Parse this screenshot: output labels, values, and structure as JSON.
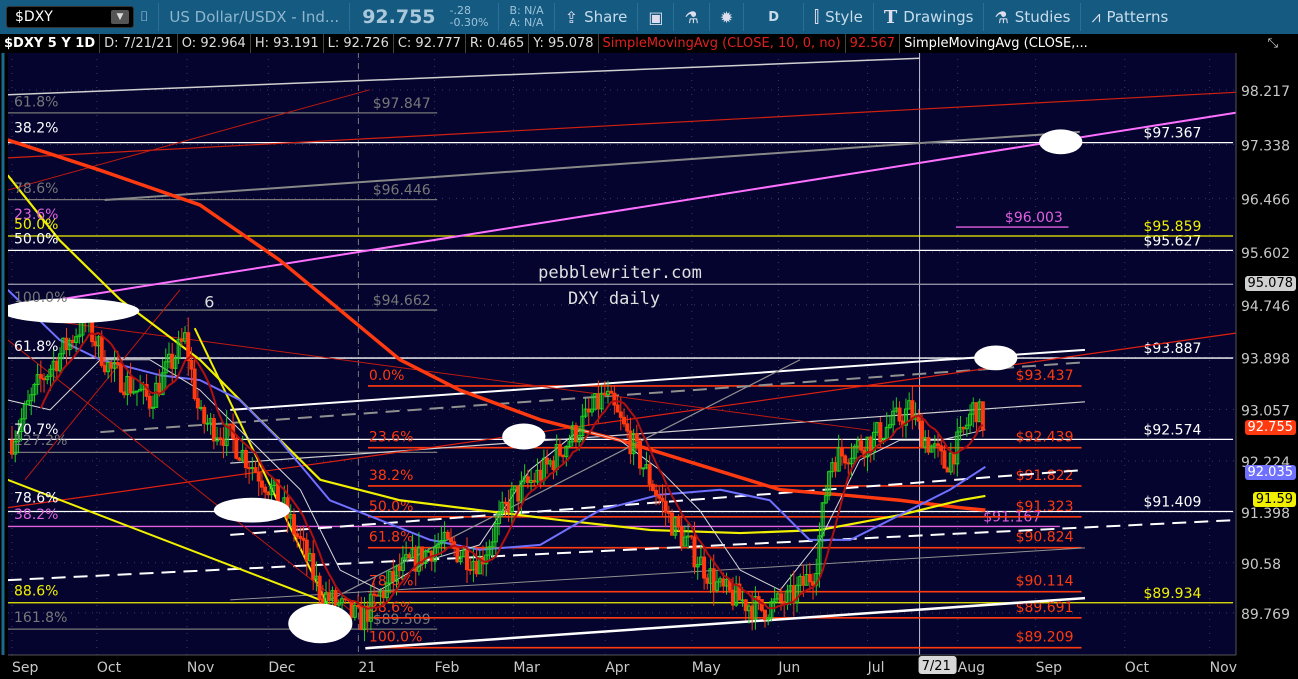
{
  "toolbar": {
    "symbol": "$DXY",
    "description": "US Dollar/USDX - Ind...",
    "last": "92.755",
    "change": "-.28",
    "change_pct": "-0.30%",
    "bid": "B: N/A",
    "ask": "A: N/A",
    "share": "Share",
    "aggregation": "D",
    "style": "Style",
    "drawings": "Drawings",
    "studies": "Studies",
    "patterns": "Patterns"
  },
  "status": {
    "title": "$DXY 5 Y 1D",
    "date": "D: 7/21/21",
    "open": "O: 92.964",
    "high": "H: 93.191",
    "low": "L: 92.726",
    "close": "C: 92.777",
    "range": "R: 0.465",
    "year": "Y: 95.078",
    "study1": "SimpleMovingAvg (CLOSE, 10, 0, no)",
    "study1_value": "92.567",
    "study2": "SimpleMovingAvg (CLOSE,..."
  },
  "colors": {
    "bg": "#04042e",
    "red": "#ff3a10",
    "yellow": "#f0f000",
    "pink": "#e060e0",
    "blue": "#7070ff",
    "white": "#ffffff",
    "gray": "#808080",
    "darkred": "#b01010"
  },
  "chart_data": {
    "type": "line",
    "title": "$DXY 5 Y 1D",
    "annotation_text": [
      "pebblewriter.com",
      "DXY daily"
    ],
    "ylim": [
      89.2,
      98.6
    ],
    "y_ticks": [
      98.217,
      97.338,
      96.466,
      95.602,
      94.746,
      93.898,
      93.057,
      92.224,
      91.398,
      90.58,
      89.769
    ],
    "x_ticks": [
      {
        "label": "Sep",
        "t": 0
      },
      {
        "label": "Oct",
        "t": 0.98
      },
      {
        "label": "Nov",
        "t": 2.02
      },
      {
        "label": "Dec",
        "t": 2.96
      },
      {
        "label": "21",
        "t": 4.0
      },
      {
        "label": "Feb",
        "t": 4.88
      },
      {
        "label": "Mar",
        "t": 5.79
      },
      {
        "label": "Apr",
        "t": 6.85
      },
      {
        "label": "May",
        "t": 7.85
      },
      {
        "label": "Jun",
        "t": 8.85
      },
      {
        "label": "Jul",
        "t": 9.88
      },
      {
        "label": "Aug",
        "t": 10.92
      },
      {
        "label": "Sep",
        "t": 11.82
      },
      {
        "label": "Oct",
        "t": 12.85
      },
      {
        "label": "Nov",
        "t": 13.83
      }
    ],
    "cursor": {
      "label": "7/21",
      "t": 10.48
    },
    "price_badges": [
      {
        "value": "95.078",
        "price": 95.078,
        "color": "#d0d0d0",
        "text": "#000"
      },
      {
        "value": "92.755",
        "price": 92.755,
        "color": "#ff3a10",
        "text": "#fff"
      },
      {
        "value": "92.035",
        "price": 92.035,
        "color": "#7070ff",
        "text": "#fff"
      },
      {
        "value": "91.59",
        "price": 91.59,
        "color": "#f0f000",
        "text": "#000"
      }
    ],
    "close_series": {
      "name": "$DXY close (approx)",
      "t": [
        0,
        0.32,
        0.84,
        1.13,
        1.59,
        2.0,
        2.17,
        2.52,
        3.09,
        3.33,
        3.56,
        4.02,
        4.48,
        4.94,
        5.4,
        5.75,
        6.15,
        6.85,
        7.14,
        7.6,
        8.18,
        8.64,
        8.98,
        9.27,
        9.45,
        9.91,
        10.37,
        10.48,
        10.77,
        10.95,
        11.12,
        11.24
      ],
      "values": [
        92.56,
        93.5,
        94.5,
        93.7,
        93.2,
        94.2,
        92.9,
        92.6,
        91.6,
        90.9,
        90.1,
        89.65,
        90.46,
        90.9,
        90.6,
        91.6,
        92.08,
        93.29,
        92.56,
        91.27,
        90.14,
        89.82,
        89.98,
        90.46,
        92.24,
        92.56,
        93.05,
        92.72,
        92.16,
        92.56,
        93.13,
        92.76
      ]
    },
    "moving_averages": [
      {
        "name": "sma-red-long",
        "color": "#ff3a10",
        "width": 3.5,
        "points": [
          [
            -0.05,
            97.41
          ],
          [
            1.02,
            96.92
          ],
          [
            2.17,
            96.36
          ],
          [
            3.09,
            95.47
          ],
          [
            3.79,
            94.66
          ],
          [
            4.48,
            93.86
          ],
          [
            5.17,
            93.37
          ],
          [
            6.1,
            92.89
          ],
          [
            7.02,
            92.56
          ],
          [
            7.94,
            92.16
          ],
          [
            8.87,
            91.76
          ],
          [
            9.56,
            91.68
          ],
          [
            10.25,
            91.59
          ],
          [
            10.95,
            91.47
          ],
          [
            11.24,
            91.43
          ]
        ]
      },
      {
        "name": "sma-yellow",
        "color": "#f0f000",
        "width": 2.2,
        "points": [
          [
            -0.05,
            96.84
          ],
          [
            0.55,
            95.79
          ],
          [
            1.25,
            94.83
          ],
          [
            2.17,
            93.86
          ],
          [
            2.86,
            92.89
          ],
          [
            3.56,
            91.92
          ],
          [
            4.48,
            91.59
          ],
          [
            5.4,
            91.43
          ],
          [
            6.33,
            91.27
          ],
          [
            7.37,
            91.11
          ],
          [
            8.41,
            91.06
          ],
          [
            9.33,
            91.11
          ],
          [
            10.25,
            91.35
          ],
          [
            10.95,
            91.59
          ],
          [
            11.24,
            91.66
          ]
        ]
      },
      {
        "name": "sma-blue",
        "color": "#7070ff",
        "width": 2,
        "points": [
          [
            -0.05,
            94.99
          ],
          [
            0.55,
            94.18
          ],
          [
            1.02,
            93.86
          ],
          [
            1.71,
            93.61
          ],
          [
            2.17,
            93.53
          ],
          [
            2.63,
            93.21
          ],
          [
            3.09,
            92.56
          ],
          [
            3.67,
            91.59
          ],
          [
            4.25,
            91.27
          ],
          [
            4.83,
            90.95
          ],
          [
            5.4,
            90.79
          ],
          [
            6.1,
            90.87
          ],
          [
            6.79,
            91.43
          ],
          [
            7.48,
            91.68
          ],
          [
            8.18,
            91.76
          ],
          [
            8.75,
            91.59
          ],
          [
            9.21,
            90.95
          ],
          [
            9.68,
            90.95
          ],
          [
            10.25,
            91.35
          ],
          [
            10.83,
            91.76
          ],
          [
            11.24,
            92.13
          ]
        ]
      },
      {
        "name": "sma-white",
        "color": "#d8d8d8",
        "width": 1,
        "points": [
          [
            -0.05,
            93.21
          ],
          [
            0.44,
            93.05
          ],
          [
            1.02,
            93.86
          ],
          [
            1.59,
            93.86
          ],
          [
            2.17,
            93.37
          ],
          [
            2.75,
            92.56
          ],
          [
            3.33,
            91.76
          ],
          [
            3.79,
            90.46
          ],
          [
            4.25,
            90.14
          ],
          [
            4.83,
            90.63
          ],
          [
            5.4,
            90.87
          ],
          [
            5.98,
            92.08
          ],
          [
            6.56,
            92.73
          ],
          [
            7.02,
            92.56
          ],
          [
            7.48,
            92.08
          ],
          [
            7.94,
            91.43
          ],
          [
            8.41,
            90.46
          ],
          [
            8.87,
            90.14
          ],
          [
            9.33,
            90.95
          ],
          [
            9.79,
            92.24
          ],
          [
            10.25,
            92.56
          ],
          [
            10.72,
            92.56
          ],
          [
            11.24,
            92.73
          ]
        ]
      }
    ],
    "trendlines": [
      {
        "color": "#ff70ff",
        "w": 2,
        "a": [
          -0.05,
          94.7
        ],
        "b": [
          14.13,
          97.85
        ]
      },
      {
        "color": "#d0d0d0",
        "w": 1.5,
        "a": [
          -0.05,
          98.14
        ],
        "b": [
          10.48,
          98.73
        ]
      },
      {
        "color": "#d02010",
        "w": 1.2,
        "a": [
          -0.05,
          97.12
        ],
        "b": [
          14.13,
          98.18
        ]
      },
      {
        "color": "#888888",
        "w": 2,
        "a": [
          1.07,
          96.44
        ],
        "b": [
          12.33,
          97.54
        ]
      },
      {
        "color": "#ffffff",
        "w": 2,
        "a": [
          2.52,
          93.05
        ],
        "b": [
          12.39,
          94.02
        ]
      },
      {
        "color": "#d0d0d0",
        "w": 1.2,
        "a": [
          2.52,
          92.19
        ],
        "b": [
          12.39,
          93.18
        ]
      },
      {
        "color": "#ffffff",
        "w": 2.5,
        "a": [
          4.08,
          89.2
        ],
        "b": [
          12.39,
          90.01
        ]
      },
      {
        "color": "#ffffff",
        "w": 2,
        "dash": "14 8",
        "a": [
          -0.05,
          90.3
        ],
        "b": [
          14.13,
          91.27
        ]
      },
      {
        "color": "#ffffff",
        "w": 2,
        "dash": "14 8",
        "a": [
          2.52,
          91.03
        ],
        "b": [
          12.39,
          92.08
        ]
      },
      {
        "color": "#909090",
        "w": 2,
        "dash": "14 8",
        "a": [
          1.02,
          92.69
        ],
        "b": [
          12.39,
          93.82
        ]
      },
      {
        "color": "#e02010",
        "w": 1.2,
        "a": [
          -0.05,
          91.47
        ],
        "b": [
          14.13,
          94.29
        ]
      },
      {
        "color": "#909090",
        "w": 1.2,
        "a": [
          3.67,
          89.98
        ],
        "b": [
          9.1,
          93.86
        ]
      },
      {
        "color": "#909090",
        "w": 1,
        "a": [
          2.52,
          89.98
        ],
        "b": [
          12.39,
          90.82
        ]
      },
      {
        "color": "#c01a10",
        "w": 1,
        "a": [
          -0.05,
          94.58
        ],
        "b": [
          9.91,
          92.72
        ]
      },
      {
        "color": "#f0f000",
        "w": 2,
        "a": [
          -0.05,
          91.92
        ],
        "b": [
          3.56,
          89.98
        ]
      },
      {
        "color": "#f0f000",
        "w": 2,
        "a": [
          2.11,
          94.37
        ],
        "b": [
          3.67,
          89.82
        ]
      },
      {
        "color": "#c01a10",
        "w": 1,
        "a": [
          -0.05,
          94.18
        ],
        "b": [
          3.9,
          89.82
        ]
      },
      {
        "color": "#c01a10",
        "w": 1,
        "a": [
          0.15,
          91.92
        ],
        "b": [
          1.94,
          94.99
        ]
      },
      {
        "color": "#c01a10",
        "w": 1,
        "a": [
          -0.05,
          96.6
        ],
        "b": [
          4.13,
          98.22
        ]
      }
    ],
    "levels": [
      {
        "price": 97.367,
        "label": "$97.367",
        "color": "#ffffff",
        "from": -0.1,
        "to": 14.1,
        "label_t": 13.4
      },
      {
        "price": 95.627,
        "label": "$95.627",
        "color": "#ffffff",
        "from": -0.1,
        "to": 14.1,
        "label_t": 13.4
      },
      {
        "price": 95.859,
        "label": "$95.859",
        "color": "#f0f000",
        "from": -0.1,
        "to": 14.1,
        "label_t": 13.4
      },
      {
        "price": 93.887,
        "label": "$93.887",
        "color": "#ffffff",
        "from": -0.1,
        "to": 14.1,
        "label_t": 13.4
      },
      {
        "price": 92.574,
        "label": "$92.574",
        "color": "#ffffff",
        "from": -0.1,
        "to": 14.1,
        "label_t": 13.4
      },
      {
        "price": 91.409,
        "label": "$91.409",
        "color": "#ffffff",
        "from": -0.1,
        "to": 14.1,
        "label_t": 13.4
      },
      {
        "price": 89.934,
        "label": "$89.934",
        "color": "#f0f000",
        "from": -0.1,
        "to": 14.1,
        "label_t": 13.4
      },
      {
        "price": 95.078,
        "label": "",
        "color": "#9090a0",
        "from": -0.1,
        "to": 14.1,
        "label_t": 13.4
      },
      {
        "price": 96.003,
        "label": "$96.003",
        "color": "#e060e0",
        "from": 10.9,
        "to": 12.2,
        "label_t": 11.8
      },
      {
        "price": 91.167,
        "label": "$91.167",
        "color": "#e060e0",
        "from": -0.1,
        "to": 12.1,
        "label_t": 11.55
      },
      {
        "price": 97.847,
        "label": "$97.847",
        "color": "#777777",
        "from": -0.1,
        "to": 4.91,
        "label_t": 4.5
      },
      {
        "price": 96.446,
        "label": "$96.446",
        "color": "#777777",
        "from": -0.1,
        "to": 4.91,
        "label_t": 4.5
      },
      {
        "price": 94.662,
        "label": "$94.662",
        "color": "#777777",
        "from": -0.1,
        "to": 4.91,
        "label_t": 4.5
      },
      {
        "price": 89.509,
        "label": "$89.509",
        "color": "#777777",
        "from": -0.1,
        "to": 4.91,
        "label_t": 4.5
      },
      {
        "price": 92.364,
        "label": "",
        "color": "#777777",
        "from": -0.1,
        "to": 4.91,
        "label_t": 4.5
      }
    ],
    "fib_retracement": {
      "color": "#ff3a10",
      "from": 4.11,
      "to": 12.35,
      "levels": [
        {
          "pct": "0.0%",
          "price": 93.437,
          "label": "$93.437"
        },
        {
          "pct": "23.6%",
          "price": 92.439,
          "label": "$92.439"
        },
        {
          "pct": "38.2%",
          "price": 91.822,
          "label": "$91.822"
        },
        {
          "pct": "50.0%",
          "price": 91.323,
          "label": "$91.323"
        },
        {
          "pct": "61.8%",
          "price": 90.824,
          "label": "$90.824"
        },
        {
          "pct": "78.6%",
          "price": 90.114,
          "label": "$90.114"
        },
        {
          "pct": "88.6%",
          "price": 89.691,
          "label": "$89.691"
        },
        {
          "pct": "100.0%",
          "price": 89.209,
          "label": "$89.209"
        }
      ]
    },
    "left_labels": [
      {
        "text": "61.8%",
        "price": 97.95,
        "color": "#777777"
      },
      {
        "text": "38.2%",
        "price": 97.53,
        "color": "#ffffff"
      },
      {
        "text": "78.6%",
        "price": 96.55,
        "color": "#777777"
      },
      {
        "text": "23.6%",
        "price": 96.13,
        "color": "#e060e0"
      },
      {
        "text": "50.0%",
        "price": 95.97,
        "color": "#f0f000"
      },
      {
        "text": "50.0%",
        "price": 95.74,
        "color": "#ffffff"
      },
      {
        "text": "100.0%",
        "price": 94.79,
        "color": "#777777"
      },
      {
        "text": "61.8%",
        "price": 94.0,
        "color": "#ffffff"
      },
      {
        "text": "70.7%",
        "price": 92.66,
        "color": "#ffffff"
      },
      {
        "text": "127.2%",
        "price": 92.48,
        "color": "#777777"
      },
      {
        "text": "78.6%",
        "price": 91.55,
        "color": "#ffffff"
      },
      {
        "text": "38.2%",
        "price": 91.29,
        "color": "#e060e0"
      },
      {
        "text": "88.6%",
        "price": 90.05,
        "color": "#f0f000"
      },
      {
        "text": "161.8%",
        "price": 89.62,
        "color": "#777777"
      }
    ],
    "wave_label": {
      "text": "6",
      "t": 2.22,
      "price": 94.7
    },
    "highlight_ellipses": [
      {
        "t": 0.67,
        "price": 94.65,
        "rt": 0.8,
        "rp": 0.2
      },
      {
        "t": 12.11,
        "price": 97.38,
        "rt": 0.25,
        "rp": 0.2
      },
      {
        "t": 11.36,
        "price": 93.89,
        "rt": 0.25,
        "rp": 0.2
      },
      {
        "t": 5.91,
        "price": 92.62,
        "rt": 0.25,
        "rp": 0.21
      },
      {
        "t": 2.77,
        "price": 91.43,
        "rt": 0.44,
        "rp": 0.2
      },
      {
        "t": 3.56,
        "price": 89.6,
        "rt": 0.37,
        "rp": 0.32
      }
    ]
  }
}
